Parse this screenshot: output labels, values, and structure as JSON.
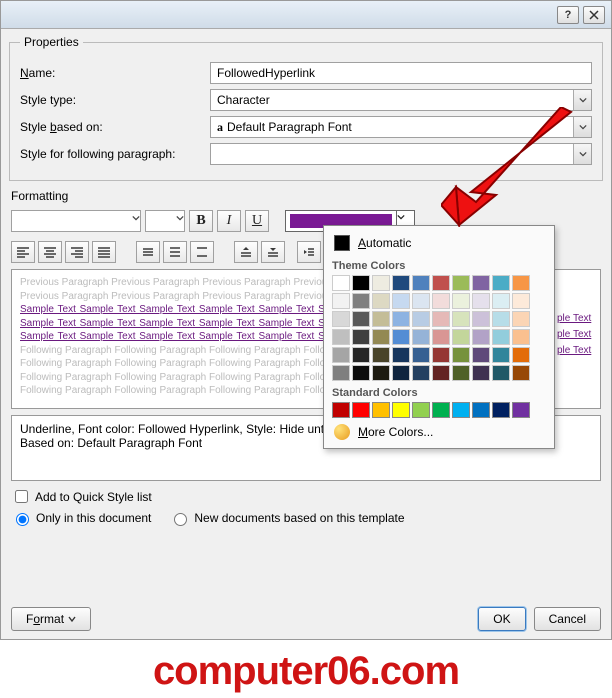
{
  "groups": {
    "properties": "Properties",
    "formatting": "Formatting"
  },
  "fields": {
    "name_label_pre": "",
    "name_al": "N",
    "name_label_post": "ame:",
    "name_value": "FollowedHyperlink",
    "styletype_label": "Style type:",
    "styletype_value": "Character",
    "basedon_pre": "Style ",
    "basedon_al": "b",
    "basedon_post": "ased on:",
    "basedon_value": "Default Paragraph Font",
    "basedon_prefix_glyph": "a",
    "following_label": "Style for following paragraph:",
    "following_value": ""
  },
  "format_buttons": {
    "bold": "B",
    "italic": "I",
    "underline": "U"
  },
  "preview": {
    "prev_line": "Previous Paragraph Previous Paragraph Previous Paragraph Previous Paragraph",
    "sample_line": "Sample Text Sample Text Sample Text Sample Text Sample Text Sample Text",
    "follow_line": "Following Paragraph Following Paragraph Following Paragraph Following Paragraph"
  },
  "peek_sample": "ple Text",
  "description": {
    "line1": "Underline, Font color: Followed Hyperlink, Style: Hide until used",
    "line2": "Based on: Default Paragraph Font"
  },
  "options": {
    "quicklist_label": "Add to Quick Style list",
    "only_doc_label": "Only in this document",
    "newdocs_label": "New documents based on this template"
  },
  "buttons": {
    "format_pre": "F",
    "format_al": "o",
    "format_post": "rmat",
    "ok": "OK",
    "cancel": "Cancel"
  },
  "color_popup": {
    "automatic_al": "A",
    "automatic_rest": "utomatic",
    "theme_title": "Theme Colors",
    "standard_title": "Standard Colors",
    "more_al": "M",
    "more_rest": "ore Colors..."
  },
  "theme_rows": [
    [
      "#ffffff",
      "#000000",
      "#eeece1",
      "#1f497d",
      "#4f81bd",
      "#c0504d",
      "#9bbb59",
      "#8064a2",
      "#4bacc6",
      "#f79646"
    ],
    [
      "#f2f2f2",
      "#7f7f7f",
      "#ddd9c3",
      "#c6d9f0",
      "#dbe5f1",
      "#f2dcdb",
      "#ebf1dd",
      "#e5e0ec",
      "#dbeef3",
      "#fdeada"
    ],
    [
      "#d8d8d8",
      "#595959",
      "#c4bd97",
      "#8db3e2",
      "#b8cce4",
      "#e5b9b7",
      "#d7e3bc",
      "#ccc1d9",
      "#b7dde8",
      "#fbd5b5"
    ],
    [
      "#bfbfbf",
      "#3f3f3f",
      "#938953",
      "#548dd4",
      "#95b3d7",
      "#d99694",
      "#c3d69b",
      "#b2a2c7",
      "#92cddc",
      "#fac08f"
    ],
    [
      "#a5a5a5",
      "#262626",
      "#494429",
      "#17365d",
      "#366092",
      "#953734",
      "#76923c",
      "#5f497a",
      "#31859b",
      "#e36c09"
    ],
    [
      "#7f7f7f",
      "#0c0c0c",
      "#1d1b10",
      "#0f243e",
      "#244061",
      "#632423",
      "#4f6128",
      "#3f3151",
      "#205867",
      "#974806"
    ]
  ],
  "standard_colors": [
    "#c00000",
    "#ff0000",
    "#ffc000",
    "#ffff00",
    "#92d050",
    "#00b050",
    "#00b0f0",
    "#0070c0",
    "#002060",
    "#7030a0"
  ],
  "watermark": "computer06.com"
}
